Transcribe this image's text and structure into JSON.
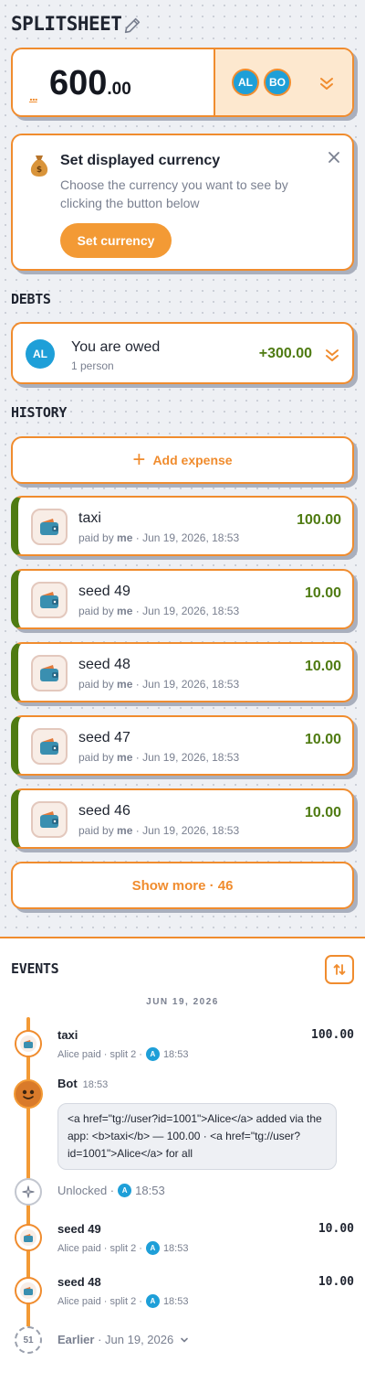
{
  "header": {
    "brand": "SPLITSHEET"
  },
  "balance": {
    "prefix": "...",
    "amount": "600",
    "cents": ".00",
    "participants": [
      "AL",
      "BO"
    ]
  },
  "currency_prompt": {
    "title": "Set displayed currency",
    "description": "Choose the currency you want to see by clicking the button below",
    "button": "Set currency"
  },
  "debts": {
    "heading": "DEBTS",
    "avatar": "AL",
    "title": "You are owed",
    "subtitle": "1 person",
    "amount": "+300.00"
  },
  "history": {
    "heading": "HISTORY",
    "add_label": "Add expense",
    "items": [
      {
        "name": "taxi",
        "payer": "me",
        "date": "Jun 19, 2026, 18:53",
        "amount": "100.00"
      },
      {
        "name": "seed 49",
        "payer": "me",
        "date": "Jun 19, 2026, 18:53",
        "amount": "10.00"
      },
      {
        "name": "seed 48",
        "payer": "me",
        "date": "Jun 19, 2026, 18:53",
        "amount": "10.00"
      },
      {
        "name": "seed 47",
        "payer": "me",
        "date": "Jun 19, 2026, 18:53",
        "amount": "10.00"
      },
      {
        "name": "seed 46",
        "payer": "me",
        "date": "Jun 19, 2026, 18:53",
        "amount": "10.00"
      }
    ],
    "paid_by_label": "paid by",
    "show_more": "Show more · 46"
  },
  "events": {
    "heading": "EVENTS",
    "date": "JUN 19, 2026",
    "items": [
      {
        "title": "taxi",
        "meta": "Alice paid · split 2 ·",
        "avatar": "A",
        "time": "18:53",
        "amount": "100.00"
      },
      {
        "title": "seed 49",
        "meta": "Alice paid · split 2 ·",
        "avatar": "A",
        "time": "18:53",
        "amount": "10.00"
      },
      {
        "title": "seed 48",
        "meta": "Alice paid · split 2 ·",
        "avatar": "A",
        "time": "18:53",
        "amount": "10.00"
      }
    ],
    "bot": {
      "name": "Bot",
      "time": "18:53",
      "message": "<a href=\"tg://user?id=1001\">Alice</a> added via the app: <b>taxi</b> — 100.00 · <a href=\"tg://user?id=1001\">Alice</a> for all"
    },
    "unlocked": {
      "label": "Unlocked ·",
      "avatar": "A",
      "time": "18:53"
    },
    "earlier": {
      "count": "51",
      "label": "Earlier",
      "date": "· Jun 19, 2026"
    }
  },
  "colors": {
    "accent": "#f08c2e",
    "positive": "#4f7b12",
    "avatar": "#1e9fd8"
  }
}
